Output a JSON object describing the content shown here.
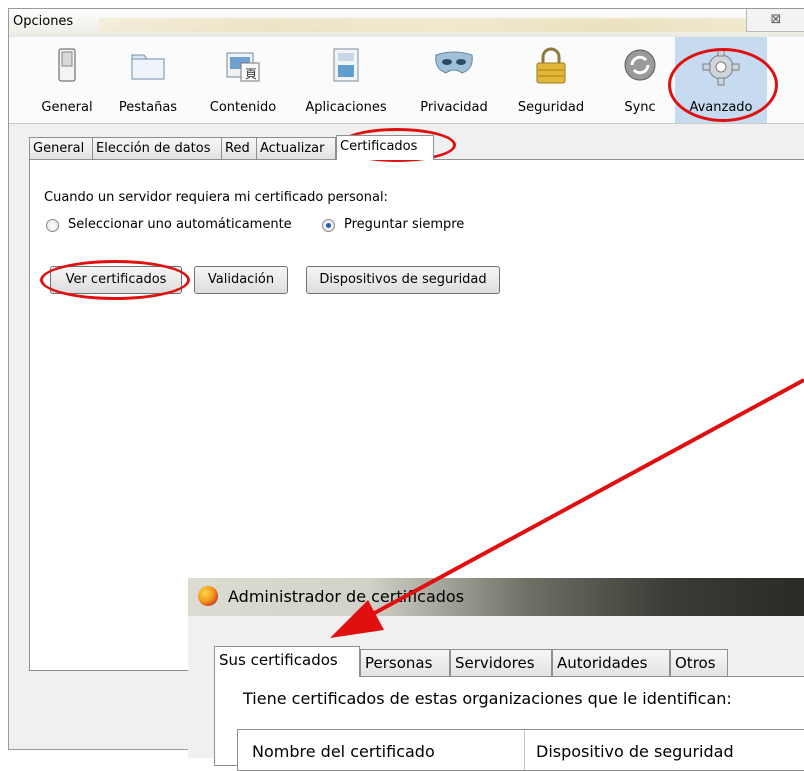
{
  "window": {
    "title": "Opciones",
    "close_glyph": "⊠"
  },
  "toolbar": {
    "items": [
      {
        "label": "General",
        "icon": "switch-icon"
      },
      {
        "label": "Pestañas",
        "icon": "tabs-icon"
      },
      {
        "label": "Contenido",
        "icon": "content-icon"
      },
      {
        "label": "Aplicaciones",
        "icon": "applications-icon"
      },
      {
        "label": "Privacidad",
        "icon": "mask-icon"
      },
      {
        "label": "Seguridad",
        "icon": "lock-icon"
      },
      {
        "label": "Sync",
        "icon": "sync-icon"
      },
      {
        "label": "Avanzado",
        "icon": "gear-icon",
        "selected": true
      }
    ]
  },
  "tabs": [
    {
      "label": "General"
    },
    {
      "label": "Elección de datos"
    },
    {
      "label": "Red"
    },
    {
      "label": "Actualizar"
    },
    {
      "label": "Certificados",
      "active": true
    }
  ],
  "certificates": {
    "prompt": "Cuando un servidor requiera mi certificado personal:",
    "option_auto": "Seleccionar uno automáticamente",
    "option_ask": "Preguntar siempre",
    "selected_option": "Preguntar siempre",
    "btn_view": "Ver certificados",
    "btn_validation": "Validación",
    "btn_devices": "Dispositivos de seguridad"
  },
  "dialog": {
    "title": "Administrador de certificados",
    "tabs": [
      {
        "label": "Sus certificados",
        "active": true
      },
      {
        "label": "Personas"
      },
      {
        "label": "Servidores"
      },
      {
        "label": "Autoridades"
      },
      {
        "label": "Otros"
      }
    ],
    "text": "Tiene certificados de estas organizaciones que le identifican:",
    "col_1": "Nombre del certificado",
    "col_2": "Dispositivo de seguridad"
  },
  "annotation_color": "#e01010"
}
